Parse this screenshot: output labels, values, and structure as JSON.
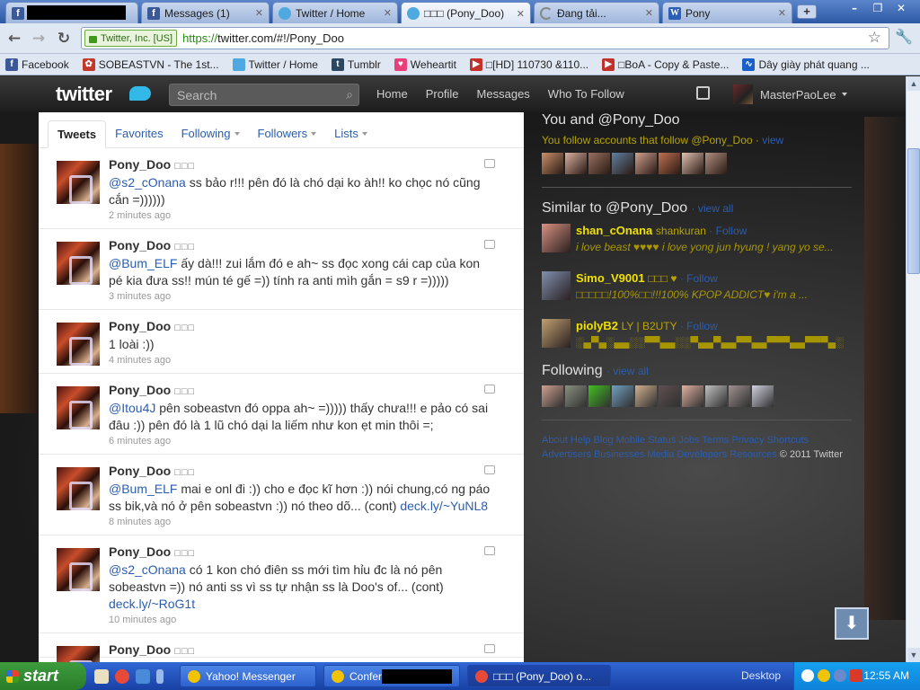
{
  "browser": {
    "tabs": [
      {
        "label": "",
        "icon": "facebook-icon"
      },
      {
        "label": "Messages (1)",
        "icon": "facebook-icon"
      },
      {
        "label": "Twitter / Home",
        "icon": "twitter-icon"
      },
      {
        "label": "□□□ (Pony_Doo)",
        "icon": "twitter-icon"
      },
      {
        "label": "Đang tải...",
        "icon": "loading-icon"
      },
      {
        "label": "Pony",
        "icon": "wikipedia-icon"
      }
    ],
    "new_tab_label": "+",
    "window_buttons": {
      "minimize": "–",
      "maximize": "❐",
      "close": "✕"
    },
    "ev_badge": "Twitter, Inc. [US]",
    "url_scheme": "https://",
    "url_rest": "twitter.com/#!/Pony_Doo",
    "bookmarks": [
      {
        "label": "Facebook",
        "icon": "facebook-icon",
        "color": "#3b5998",
        "glyph": "f"
      },
      {
        "label": "SOBEASTVN - The 1st...",
        "icon": "sobeast-icon",
        "color": "#c0392b",
        "glyph": "✿"
      },
      {
        "label": "Twitter / Home",
        "icon": "twitter-icon",
        "color": "#4ea9e0",
        "glyph": ""
      },
      {
        "label": "Tumblr",
        "icon": "tumblr-icon",
        "color": "#2c4762",
        "glyph": "t"
      },
      {
        "label": "Weheartit",
        "icon": "heart-icon",
        "color": "#e8407a",
        "glyph": "♥"
      },
      {
        "label": "□[HD] 110730 &110...",
        "icon": "youtube-icon",
        "color": "#c4302b",
        "glyph": "▶"
      },
      {
        "label": "□BoA - Copy & Paste...",
        "icon": "youtube-icon",
        "color": "#c4302b",
        "glyph": "▶"
      },
      {
        "label": "Dây giày phát quang ...",
        "icon": "chart-icon",
        "color": "#1a5fc8",
        "glyph": "∿"
      }
    ]
  },
  "twitter": {
    "logo": "twitter",
    "search_placeholder": "Search",
    "nav": [
      "Home",
      "Profile",
      "Messages",
      "Who To Follow"
    ],
    "username": "MasterPaoLee",
    "timeline_tabs": [
      "Tweets",
      "Favorites",
      "Following",
      "Followers",
      "Lists"
    ],
    "tweets": [
      {
        "name": "Pony_Doo",
        "squares": "□□□",
        "mention": "@s2_cOnana",
        "text": " ss bảo r!!! pên đó là chó dại ko àh!! ko chọc nó cũng cắn =))))))",
        "link": "",
        "time": "2 minutes ago"
      },
      {
        "name": "Pony_Doo",
        "squares": "□□□",
        "mention": "@Bum_ELF",
        "text": " ấy dà!!! zui lắm đó e ah~ ss đọc xong cái cap của kon pé kia đưa ss!! mún té gế =)) tính ra anti mìh gắn = s9 r =)))))",
        "link": "",
        "time": "3 minutes ago"
      },
      {
        "name": "Pony_Doo",
        "squares": "□□□",
        "mention": "",
        "text": "1 loài :))",
        "link": "",
        "time": "4 minutes ago"
      },
      {
        "name": "Pony_Doo",
        "squares": "□□□",
        "mention": "@Itou4J",
        "text": " pên sobeastvn đó oppa ah~ =))))) thấy chưa!!! e pảo có sai đâu :)) pên đó là 1 lũ chó dại la liếm như kon ẹt min thôi =;",
        "link": "",
        "time": "6 minutes ago"
      },
      {
        "name": "Pony_Doo",
        "squares": "□□□",
        "mention": "@Bum_ELF",
        "text": " mai e onl đi :)) cho e đọc kĩ hơn :)) nói chung,có ng páo ss bik,và nó ở pên sobeastvn :)) nó theo dõ... (cont) ",
        "link": "deck.ly/~YuNL8",
        "time": "8 minutes ago"
      },
      {
        "name": "Pony_Doo",
        "squares": "□□□",
        "mention": "@s2_cOnana",
        "text": " có 1 kon chó điên ss mới tìm hỉu đc là nó pên sobeastvn =)) nó anti ss vì ss tự nhận ss là Doo's of... (cont) ",
        "link": "deck.ly/~RoG1t",
        "time": "10 minutes ago"
      },
      {
        "name": "Pony_Doo",
        "squares": "□□□",
        "mention": "",
        "text": "",
        "link": "",
        "time": ""
      }
    ],
    "dashboard": {
      "you_and": "You and @Pony_Doo",
      "you_follow": "You follow accounts that follow @Pony_Doo",
      "view": "view",
      "similar_title": "Similar to @Pony_Doo",
      "view_all": "view all",
      "similar": [
        {
          "name": "shan_cOnana",
          "real": "shankuran",
          "follow": "Follow",
          "desc": "i love beast ♥♥♥♥ i love yong jun hyung ! yang yo se..."
        },
        {
          "name": "Simo_V9001",
          "real": "□□□ ♥",
          "follow": "Follow",
          "desc": "□□□□□!100%□□!!!100% KPOP ADDICT♥ i'm a ..."
        },
        {
          "name": "piolyB2",
          "real": "LY | B2UTY",
          "follow": "Follow",
          "desc": "░▄▀▄░▄▄░░▀▀▄▄░░▀▄▄▀▄▄▀▀▄▄▀▀▀▄▄▀▀▀▄░"
        }
      ],
      "following_title": "Following",
      "footer_links": [
        "About",
        "Help",
        "Blog",
        "Mobile",
        "Status",
        "Jobs",
        "Terms",
        "Privacy",
        "Shortcuts",
        "Advertisers",
        "Businesses",
        "Media",
        "Developers",
        "Resources"
      ],
      "copyright": "© 2011 Twitter"
    }
  },
  "taskbar": {
    "start": "start",
    "tasks": [
      {
        "label": "Yahoo! Messenger",
        "icon": "yahoo-icon",
        "color": "#f2c300"
      },
      {
        "label": "Confere",
        "icon": "conference-icon",
        "color": "#f2c300"
      },
      {
        "label": "□□□ (Pony_Doo) o...",
        "icon": "chrome-icon",
        "color": "#e84a3a"
      }
    ],
    "desktop": "Desktop",
    "clock": "12:55 AM"
  }
}
